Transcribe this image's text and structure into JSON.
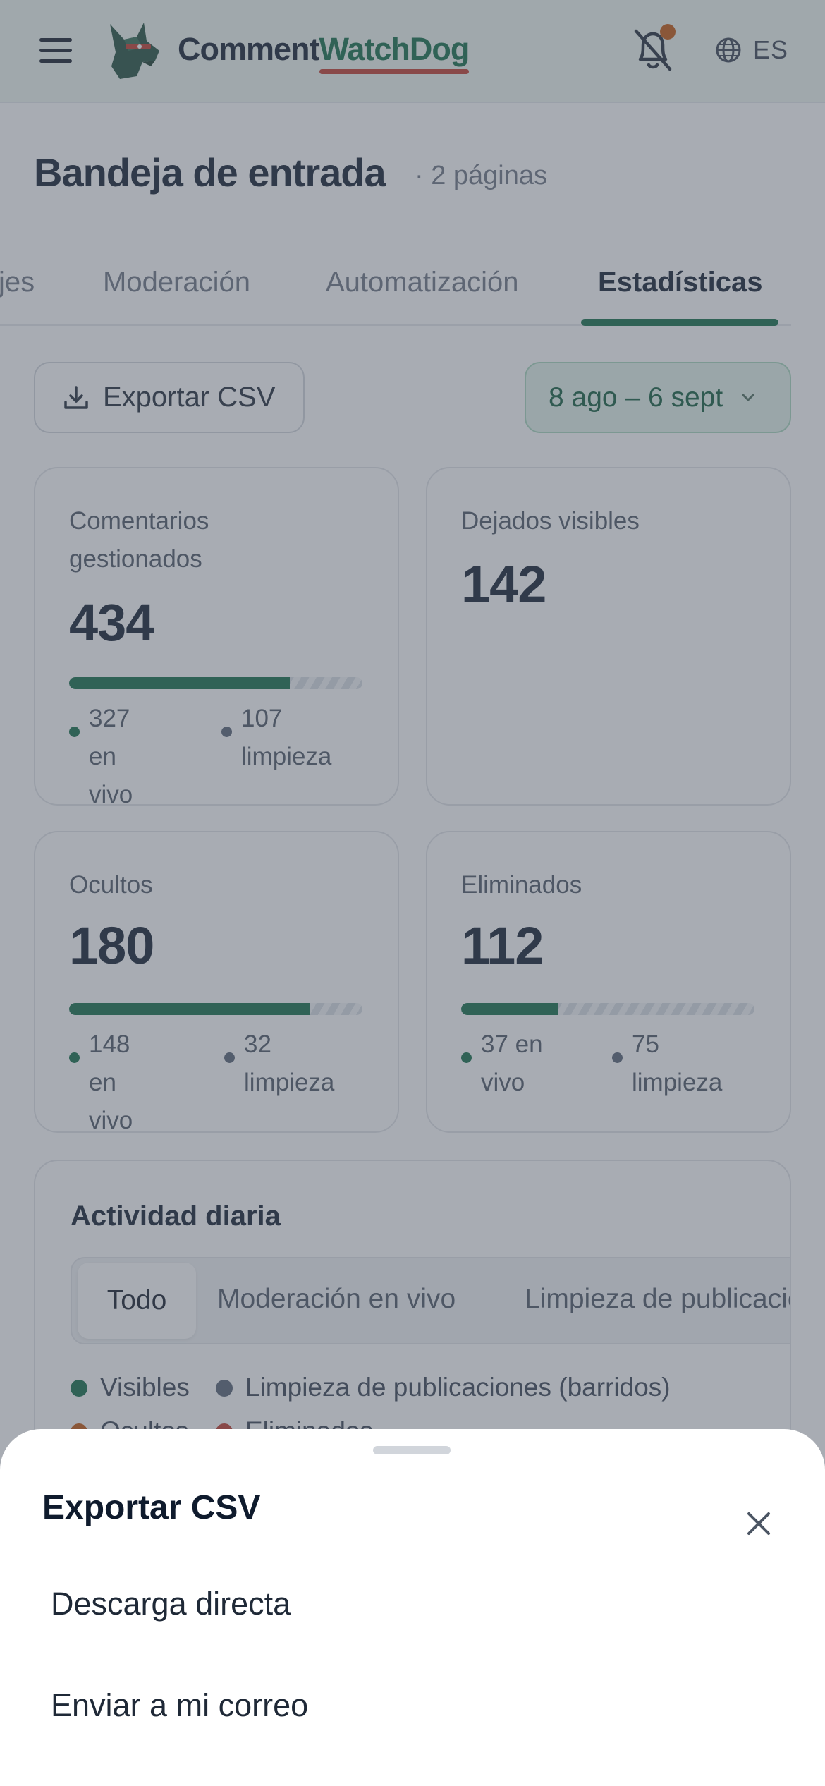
{
  "app": {
    "brand_part1": "Comment",
    "brand_part2": "WatchDog",
    "language": "ES"
  },
  "page": {
    "title": "Bandeja de entrada",
    "subtitle": "· 2 páginas"
  },
  "tabs": [
    {
      "label": "jes",
      "active": false
    },
    {
      "label": "Moderación",
      "active": false
    },
    {
      "label": "Automatización",
      "active": false
    },
    {
      "label": "Estadísticas",
      "active": true
    }
  ],
  "actions": {
    "export_label": "Exportar CSV",
    "date_range": "8 ago – 6 sept"
  },
  "cards": [
    {
      "label": "Comentarios gestionados",
      "value": "434",
      "live_fraction": 0.753,
      "live": "327 en vivo",
      "cleanup": "107 limpieza"
    },
    {
      "label": "Dejados visibles",
      "value": "142"
    },
    {
      "label": "Ocultos",
      "value": "180",
      "live_fraction": 0.822,
      "live": "148 en vivo",
      "cleanup": "32 limpieza"
    },
    {
      "label": "Eliminados",
      "value": "112",
      "live_fraction": 0.33,
      "live": "37 en vivo",
      "cleanup": "75 limpieza"
    }
  ],
  "activity": {
    "title": "Actividad diaria",
    "segments": [
      "Todo",
      "Moderación en vivo",
      "Limpieza de publicaciones"
    ],
    "active_segment": "Todo",
    "legend": [
      "Visibles",
      "Limpieza de publicaciones (barridos)",
      "Ocultos",
      "Eliminados"
    ]
  },
  "sheet": {
    "title": "Exportar CSV",
    "options": [
      "Descarga directa",
      "Enviar a mi correo"
    ]
  },
  "colors": {
    "accent": "#0e6b45",
    "notification_dot": "#c2540a",
    "underline_red": "#c0392b"
  }
}
